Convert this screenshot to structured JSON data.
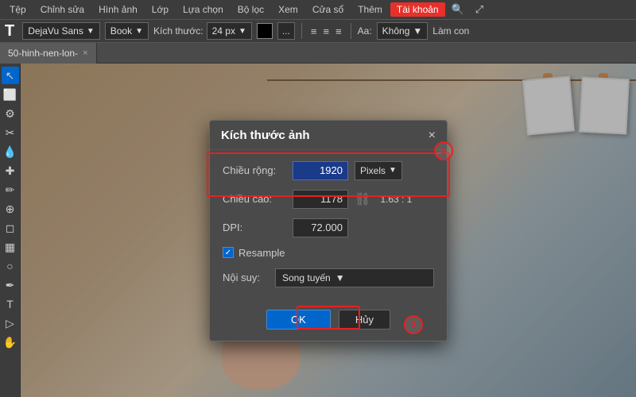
{
  "menubar": {
    "items": [
      {
        "label": "Tệp",
        "active": false
      },
      {
        "label": "Chỉnh sửa",
        "active": false
      },
      {
        "label": "Hình ảnh",
        "active": false
      },
      {
        "label": "Lớp",
        "active": false
      },
      {
        "label": "Lựa chọn",
        "active": false
      },
      {
        "label": "Bộ lọc",
        "active": false
      },
      {
        "label": "Xem",
        "active": false
      },
      {
        "label": "Cửa sổ",
        "active": false
      },
      {
        "label": "Thêm",
        "active": false
      },
      {
        "label": "Tài khoản",
        "active": true
      }
    ],
    "search_icon": "🔍",
    "resize_icon": "⤢"
  },
  "toolbar": {
    "t_label": "T",
    "font_name": "DejaVu Sans",
    "font_style": "Book",
    "size_label": "Kích thước:",
    "size_value": "24 px",
    "align_left": "≡",
    "align_center": "≡",
    "align_right": "≡",
    "aa_label": "Aa:",
    "aa_value": "Không",
    "lam_con": "Làm con"
  },
  "tab": {
    "name": "50-hinh-nen-lon-",
    "close": "×"
  },
  "dialog": {
    "title": "Kích thước ảnh",
    "close": "×",
    "width_label": "Chiều rộng:",
    "width_value": "1920",
    "unit_pixels": "Pixels",
    "height_label": "Chiều cao:",
    "height_value": "1178",
    "ratio": "1.63 : 1",
    "dpi_label": "DPI:",
    "dpi_value": "72.000",
    "resample_label": "Resample",
    "noi_suy_label": "Nội suy:",
    "noi_suy_value": "Song tuyến",
    "ok_label": "OK",
    "cancel_label": "Hủy",
    "annotation_1": "1",
    "annotation_2": "2"
  }
}
